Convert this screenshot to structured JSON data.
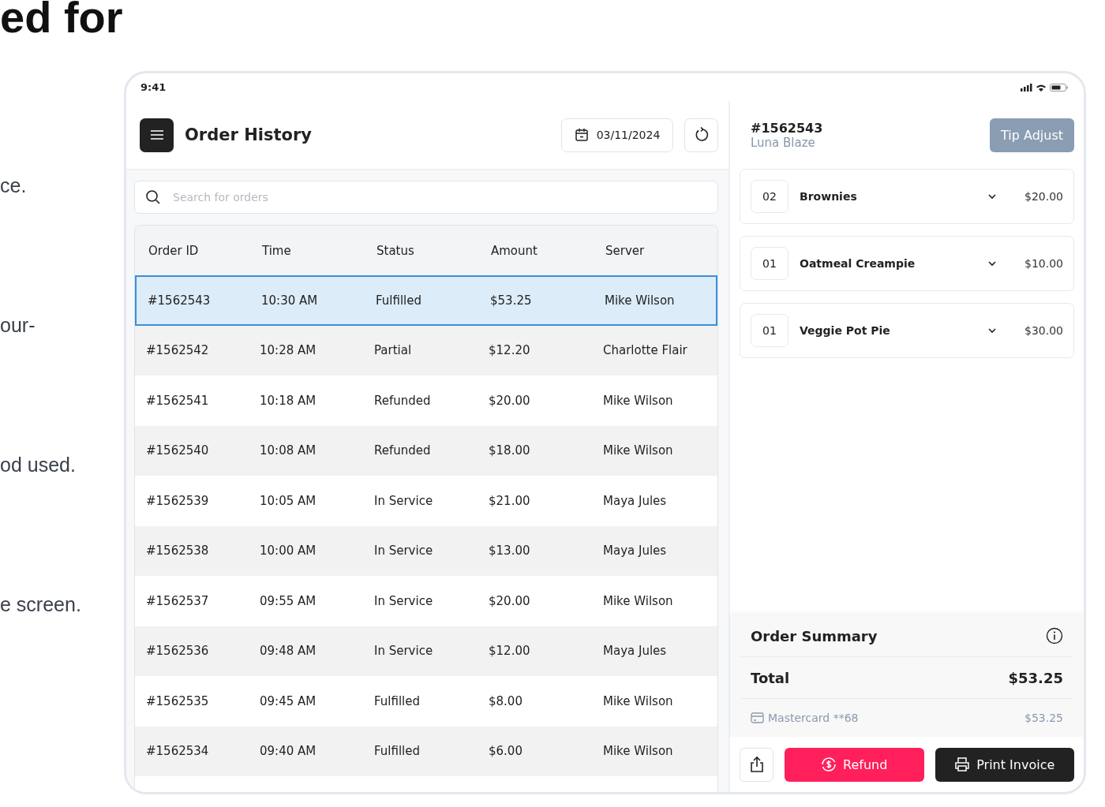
{
  "page": {
    "heading": "ed for",
    "fragments": [
      "ce.",
      "our-",
      "od used.",
      "e screen."
    ]
  },
  "status_bar": {
    "time": "9:41"
  },
  "header": {
    "title": "Order History",
    "date": "03/11/2024"
  },
  "search": {
    "placeholder": "Search for orders"
  },
  "table": {
    "columns": [
      "Order ID",
      "Time",
      "Status",
      "Amount",
      "Server"
    ],
    "rows": [
      {
        "cells": [
          "#1562543",
          "10:30 AM",
          "Fulfilled",
          "$53.25",
          "Mike Wilson"
        ],
        "selected": true
      },
      {
        "cells": [
          "#1562542",
          "10:28 AM",
          "Partial",
          "$12.20",
          "Charlotte Flair"
        ],
        "selected": false
      },
      {
        "cells": [
          "#1562541",
          "10:18 AM",
          "Refunded",
          "$20.00",
          "Mike Wilson"
        ],
        "selected": false
      },
      {
        "cells": [
          "#1562540",
          "10:08 AM",
          "Refunded",
          "$18.00",
          "Mike Wilson"
        ],
        "selected": false
      },
      {
        "cells": [
          "#1562539",
          "10:05 AM",
          "In Service",
          "$21.00",
          "Maya Jules"
        ],
        "selected": false
      },
      {
        "cells": [
          "#1562538",
          "10:00 AM",
          "In Service",
          "$13.00",
          "Maya Jules"
        ],
        "selected": false
      },
      {
        "cells": [
          "#1562537",
          "09:55 AM",
          "In Service",
          "$20.00",
          "Mike Wilson"
        ],
        "selected": false
      },
      {
        "cells": [
          "#1562536",
          "09:48 AM",
          "In Service",
          "$12.00",
          "Maya Jules"
        ],
        "selected": false
      },
      {
        "cells": [
          "#1562535",
          "09:45 AM",
          "Fulfilled",
          "$8.00",
          "Mike Wilson"
        ],
        "selected": false
      },
      {
        "cells": [
          "#1562534",
          "09:40 AM",
          "Fulfilled",
          "$6.00",
          "Mike Wilson"
        ],
        "selected": false
      }
    ]
  },
  "order": {
    "id": "#1562543",
    "customer": "Luna Blaze",
    "tip_button": "Tip Adjust",
    "items": [
      {
        "qty": "02",
        "name": "Brownies",
        "price": "$20.00"
      },
      {
        "qty": "01",
        "name": "Oatmeal Creampie",
        "price": "$10.00"
      },
      {
        "qty": "01",
        "name": "Veggie Pot Pie",
        "price": "$30.00"
      }
    ]
  },
  "summary": {
    "title": "Order Summary",
    "total_label": "Total",
    "total": "$53.25",
    "payment": "Mastercard **68",
    "payment_amount": "$53.25"
  },
  "actions": {
    "refund": "Refund",
    "print": "Print Invoice"
  }
}
